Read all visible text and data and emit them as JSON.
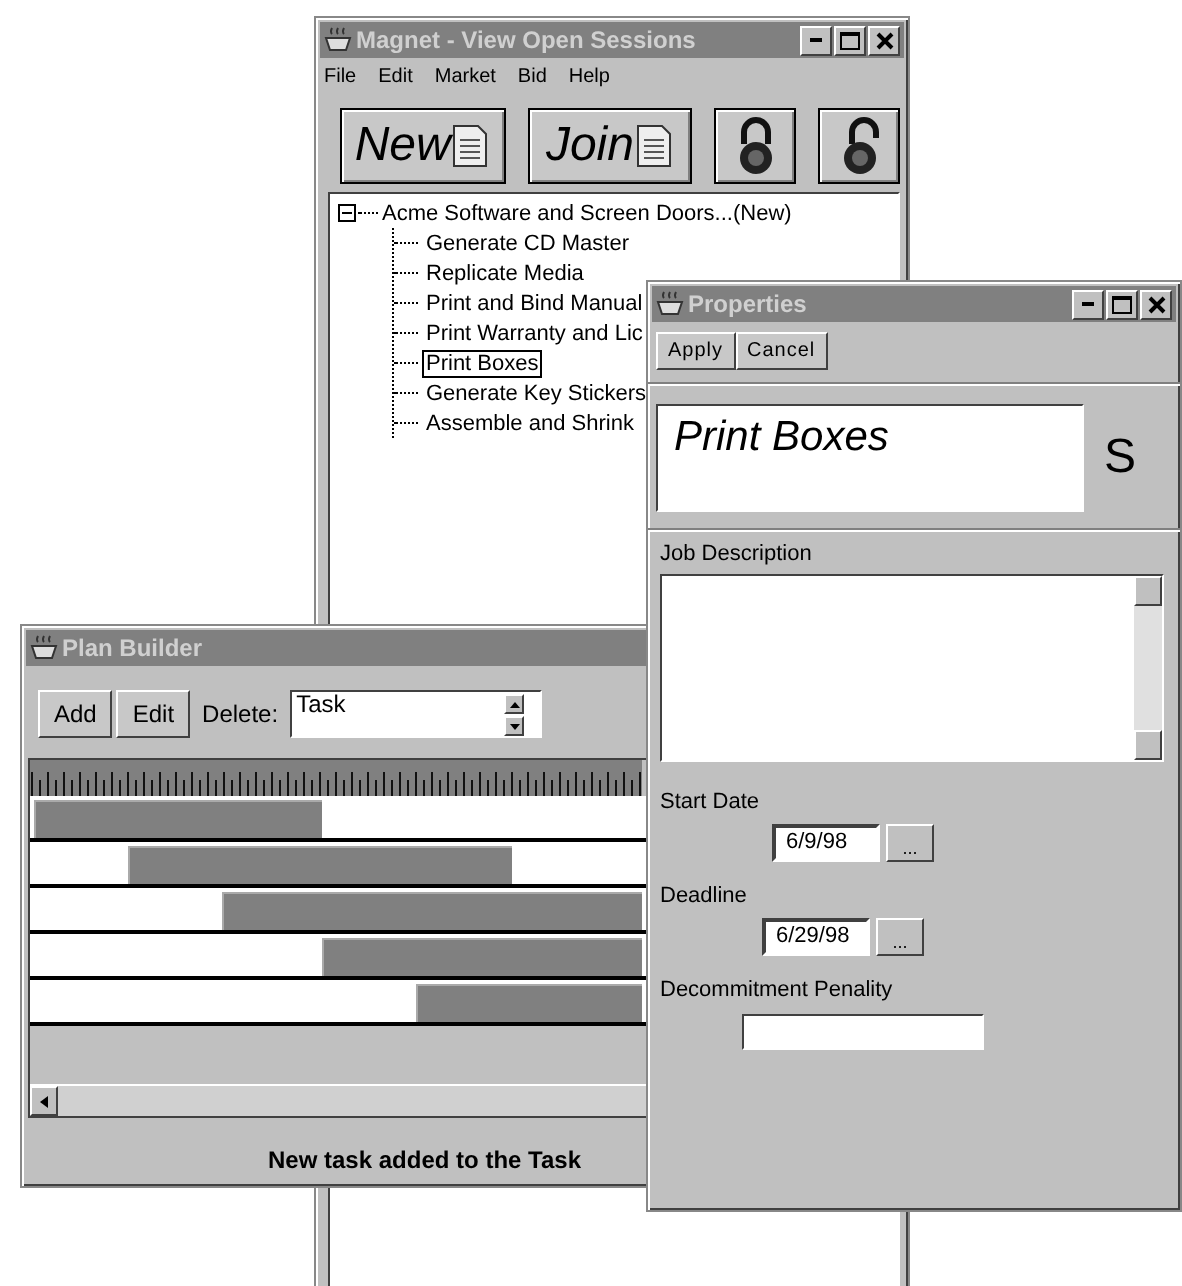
{
  "session_window": {
    "title": "Magnet - View Open Sessions",
    "menu": [
      "File",
      "Edit",
      "Market",
      "Bid",
      "Help"
    ],
    "toolbar": [
      {
        "kind": "text",
        "label": "New"
      },
      {
        "kind": "text",
        "label": "Join"
      },
      {
        "kind": "lock"
      },
      {
        "kind": "unlock"
      }
    ],
    "tree": {
      "label": "Acme Software and Screen Doors...(New)",
      "expanded": true,
      "children": [
        {
          "label": "Generate CD Master",
          "selected": false
        },
        {
          "label": "Replicate Media",
          "selected": false
        },
        {
          "label": "Print and Bind Manual",
          "selected": false
        },
        {
          "label": "Print Warranty and Lic",
          "selected": false
        },
        {
          "label": "Print Boxes",
          "selected": true
        },
        {
          "label": "Generate Key Stickers",
          "selected": false
        },
        {
          "label": "Assemble and Shrink",
          "selected": false
        }
      ]
    }
  },
  "plan_builder": {
    "title": "Plan Builder",
    "buttons": [
      "Add",
      "Edit"
    ],
    "delete_label": "Delete:",
    "delete_list": [
      "Task"
    ],
    "status": "New task added to the Task"
  },
  "properties": {
    "title": "Properties",
    "buttons": [
      "Apply",
      "Cancel"
    ],
    "name": "Print Boxes",
    "side_letter": "S",
    "fields": [
      {
        "kind": "textarea",
        "label": "Job Description"
      },
      {
        "kind": "date",
        "label": "Start Date",
        "value": "6/9/98",
        "button": "..."
      },
      {
        "kind": "date",
        "label": "Deadline",
        "value": "6/29/98",
        "button": "..."
      },
      {
        "kind": "text",
        "label": "Decommitment Penality"
      }
    ]
  }
}
